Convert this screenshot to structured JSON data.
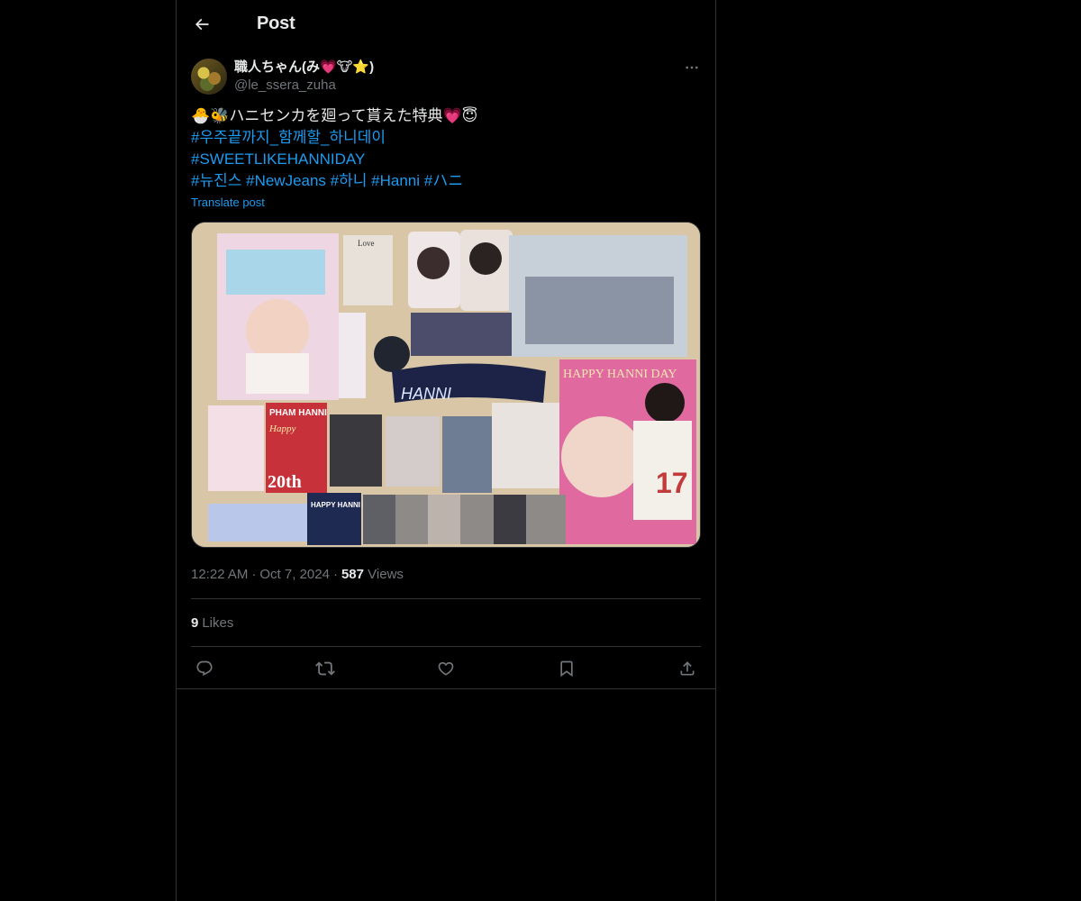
{
  "header": {
    "title": "Post"
  },
  "author": {
    "display_name": "職人ちゃん(み💗🐮⭐)",
    "handle": "@le_ssera_zuha"
  },
  "post": {
    "line1": "🐣🐝ハニセンカを廻って貰えた特典💗😇",
    "hashtag_line2": "#우주끝까지_함께할_하니데이",
    "hashtag_line3": "#SWEETLIKEHANNIDAY",
    "hashtags_line4": [
      "#뉴진스",
      "#NewJeans",
      "#하니",
      "#Hanni",
      "#ハニ"
    ],
    "translate_label": "Translate post"
  },
  "media": {
    "alt": "Photo collage of Hanni birthday cafe merchandise",
    "texts": {
      "hanni_banner": "HANNI",
      "pham_hanni": "PHAM HANNI",
      "happy": "Happy",
      "twentieth": "20th",
      "happy_hanni_day": "HAPPY HANNI DAY",
      "happy_hanni_day_small": "HAPPY HANNI DAY",
      "love": "Love",
      "jersey_number": "17"
    }
  },
  "meta": {
    "time": "12:22 AM",
    "date": "Oct 7, 2024",
    "views_count": "587",
    "views_label": "Views"
  },
  "likes": {
    "count": "9",
    "label": "Likes"
  },
  "actions": {
    "reply_icon": "reply-icon",
    "repost_icon": "repost-icon",
    "like_icon": "heart-icon",
    "bookmark_icon": "bookmark-icon",
    "share_icon": "share-icon"
  },
  "colors": {
    "background": "#000000",
    "text": "#e7e9ea",
    "muted": "#71767b",
    "accent": "#1d9bf0",
    "border": "#2f3336"
  }
}
